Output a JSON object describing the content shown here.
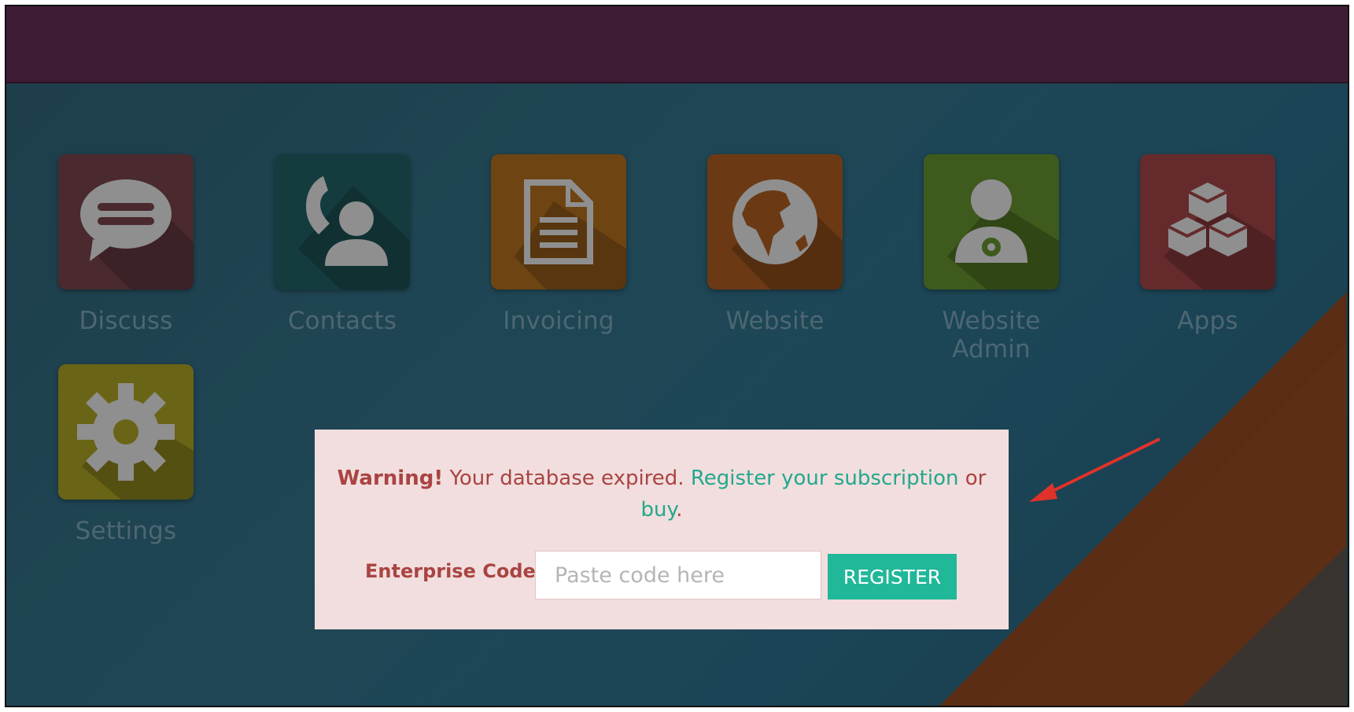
{
  "apps": [
    {
      "id": "discuss",
      "label": "Discuss",
      "color": "#4a2a2f",
      "icon": "chat-bubble-icon"
    },
    {
      "id": "contacts",
      "label": "Contacts",
      "color": "#143c3f",
      "icon": "phone-contact-icon"
    },
    {
      "id": "invoicing",
      "label": "Invoicing",
      "color": "#6e4413",
      "icon": "document-icon"
    },
    {
      "id": "website",
      "label": "Website",
      "color": "#6b3a14",
      "icon": "globe-icon"
    },
    {
      "id": "website-admin",
      "label": "Website Admin",
      "color": "#3e5a1c",
      "icon": "user-gear-icon"
    },
    {
      "id": "apps",
      "label": "Apps",
      "color": "#652a2c",
      "icon": "cubes-icon"
    },
    {
      "id": "settings",
      "label": "Settings",
      "color": "#6a6416",
      "icon": "gear-icon"
    }
  ],
  "warning": {
    "strong": "Warning!",
    "text": " Your database expired. ",
    "register_link": "Register your subscription",
    "or": " or",
    "buy_link": "buy",
    "period": "."
  },
  "enterprise": {
    "label": "Enterprise Code:",
    "placeholder": "Paste code here",
    "value": "",
    "button": "REGISTER"
  },
  "colors": {
    "topbar": "#3f1c35",
    "background": "#1f4655",
    "modal": "#f2dede",
    "warning_text": "#a94442",
    "link": "#23a88d",
    "button": "#21b799",
    "arrow": "#e0322a"
  }
}
